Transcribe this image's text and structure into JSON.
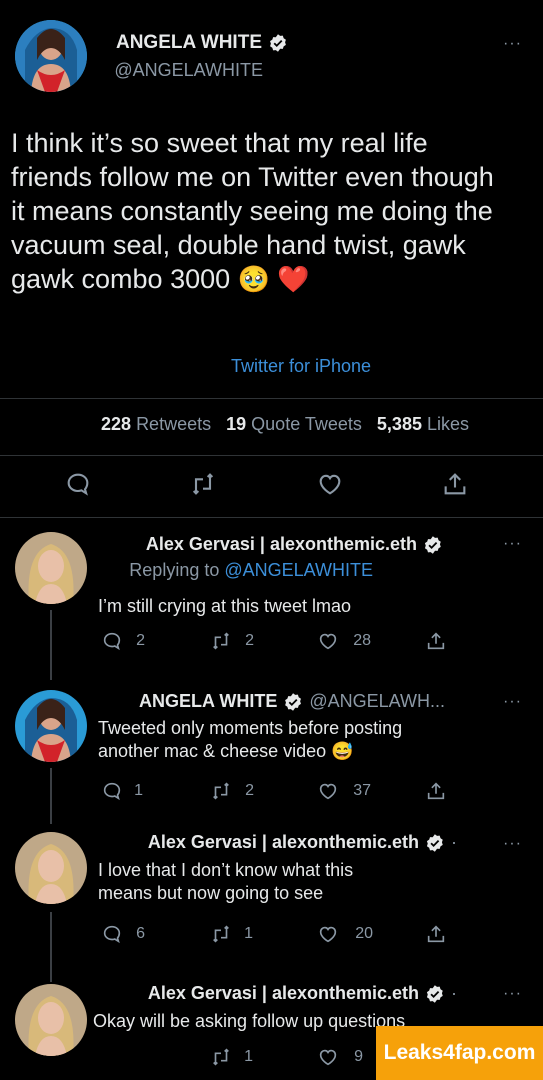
{
  "main_tweet": {
    "author_name": "ANGELA WHITE",
    "author_handle": "@ANGELAWHITE",
    "text": "I think it’s so sweet that my real life friends follow me on Twitter even though it means constantly seeing me doing the vacuum seal, double hand twist, gawk gawk combo 3000",
    "emojis": "🥹 ❤️",
    "source": "Twitter for iPhone",
    "retweets_count": "228",
    "retweets_label": "Retweets",
    "quote_count": "19",
    "quote_label": "Quote Tweets",
    "likes_count": "5,385",
    "likes_label": "Likes"
  },
  "replies": [
    {
      "author_name": "Alex Gervasi | alexonthemic.eth",
      "replying_prefix": "Replying to",
      "replying_handle": "@ANGELAWHITE",
      "text": "I’m still crying at this tweet lmao",
      "reply_count": "2",
      "retweet_count": "2",
      "like_count": "28"
    },
    {
      "author_name": "ANGELA WHITE",
      "author_handle": "@ANGELAWH...",
      "text": "Tweeted only moments before posting another mac & cheese video",
      "emoji": "😅",
      "reply_count": "1",
      "retweet_count": "2",
      "like_count": "37"
    },
    {
      "author_name": "Alex Gervasi | alexonthemic.eth",
      "author_suffix": "·",
      "text": "I love that I don’t know what this means but now going to see",
      "reply_count": "6",
      "retweet_count": "1",
      "like_count": "20"
    },
    {
      "author_name": "Alex Gervasi | alexonthemic.eth",
      "author_suffix": "·",
      "text": "Okay will be asking follow up questions",
      "retweet_count": "1",
      "like_count": "9"
    }
  ],
  "more_label": "···",
  "watermark": "Leaks4fap.com",
  "colors": {
    "background": "#000000",
    "link": "#3c8fd9",
    "muted": "#8b98a5",
    "watermark": "#f6a10a"
  },
  "icons": [
    "more-icon",
    "verified-icon",
    "reply-icon",
    "retweet-icon",
    "like-icon",
    "share-icon"
  ]
}
